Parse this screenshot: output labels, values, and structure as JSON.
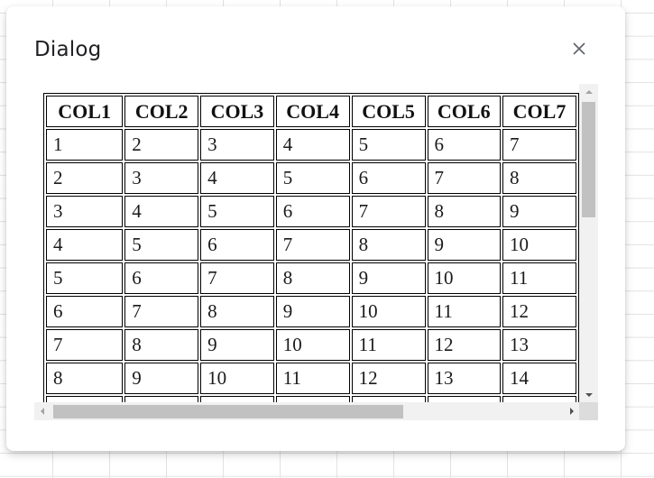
{
  "dialog": {
    "title": "Dialog",
    "close_icon": "close-x-icon"
  },
  "table": {
    "headers": [
      "COL1",
      "COL2",
      "COL3",
      "COL4",
      "COL5",
      "COL6",
      "COL7"
    ],
    "rows": [
      [
        "1",
        "2",
        "3",
        "4",
        "5",
        "6",
        "7"
      ],
      [
        "2",
        "3",
        "4",
        "5",
        "6",
        "7",
        "8"
      ],
      [
        "3",
        "4",
        "5",
        "6",
        "7",
        "8",
        "9"
      ],
      [
        "4",
        "5",
        "6",
        "7",
        "8",
        "9",
        "10"
      ],
      [
        "5",
        "6",
        "7",
        "8",
        "9",
        "10",
        "11"
      ],
      [
        "6",
        "7",
        "8",
        "9",
        "10",
        "11",
        "12"
      ],
      [
        "7",
        "8",
        "9",
        "10",
        "11",
        "12",
        "13"
      ],
      [
        "8",
        "9",
        "10",
        "11",
        "12",
        "13",
        "14"
      ],
      [
        "",
        "",
        "",
        "",
        "",
        "",
        ""
      ]
    ]
  },
  "scroll": {
    "vertical": {
      "position_fraction": 0.0,
      "visible_fraction": 0.41
    },
    "horizontal": {
      "position_fraction": 0.0,
      "visible_fraction": 0.69
    }
  },
  "colors": {
    "scrollbar_track": "#f1f1f1",
    "scrollbar_thumb": "#c1c1c1",
    "title_text": "#202124",
    "close_icon": "#5f6368"
  }
}
